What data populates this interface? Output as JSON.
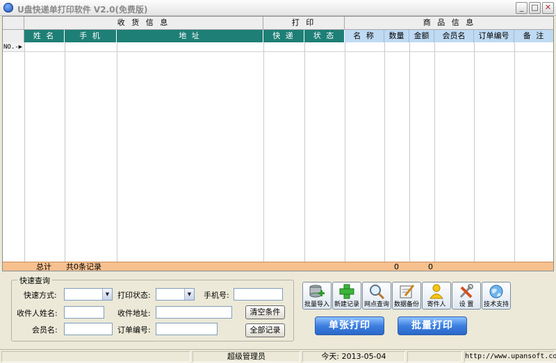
{
  "window": {
    "title": "U盘快递单打印软件 V2.0(免费版)",
    "min": "_",
    "max": "□",
    "close": "✕"
  },
  "grid": {
    "groups": [
      "收 货 信 息",
      "打 印",
      "商 品 信 息"
    ],
    "columns": [
      "姓 名",
      "手 机",
      "地 址",
      "快 递",
      "状 态",
      "名 称",
      "数量",
      "金额",
      "会员名",
      "订单编号",
      "备 注"
    ],
    "row_label": "NO.-▶",
    "totals": {
      "label": "总计",
      "records": "共0条记录",
      "qty": "0",
      "amount": "0"
    }
  },
  "query": {
    "legend": "快速查询",
    "express_label": "快速方式:",
    "print_status_label": "打印状态:",
    "phone_label": "手机号:",
    "receiver_label": "收件人姓名:",
    "address_label": "收件地址:",
    "member_label": "会员名:",
    "order_label": "订单编号:",
    "clear_btn": "清空条件",
    "all_btn": "全部记录"
  },
  "toolbar": [
    {
      "label": "批量导入",
      "icon": "database-import-icon"
    },
    {
      "label": "新建记录",
      "icon": "add-record-icon"
    },
    {
      "label": "网点查询",
      "icon": "magnifier-icon"
    },
    {
      "label": "数据备份",
      "icon": "backup-icon"
    },
    {
      "label": "寄件人",
      "icon": "person-icon"
    },
    {
      "label": "设 置",
      "icon": "tools-icon"
    },
    {
      "label": "技术支持",
      "icon": "globe-icon"
    }
  ],
  "actions": {
    "single_print": "单张打印",
    "batch_print": "批量打印"
  },
  "status": {
    "user": "超级管理员",
    "date": "今天: 2013-05-04",
    "url": "http://www.upansoft.com"
  },
  "colors": {
    "header_green": "#1e7f76",
    "header_blue": "#bfdaf2",
    "totals_orange": "#f7c08f"
  }
}
